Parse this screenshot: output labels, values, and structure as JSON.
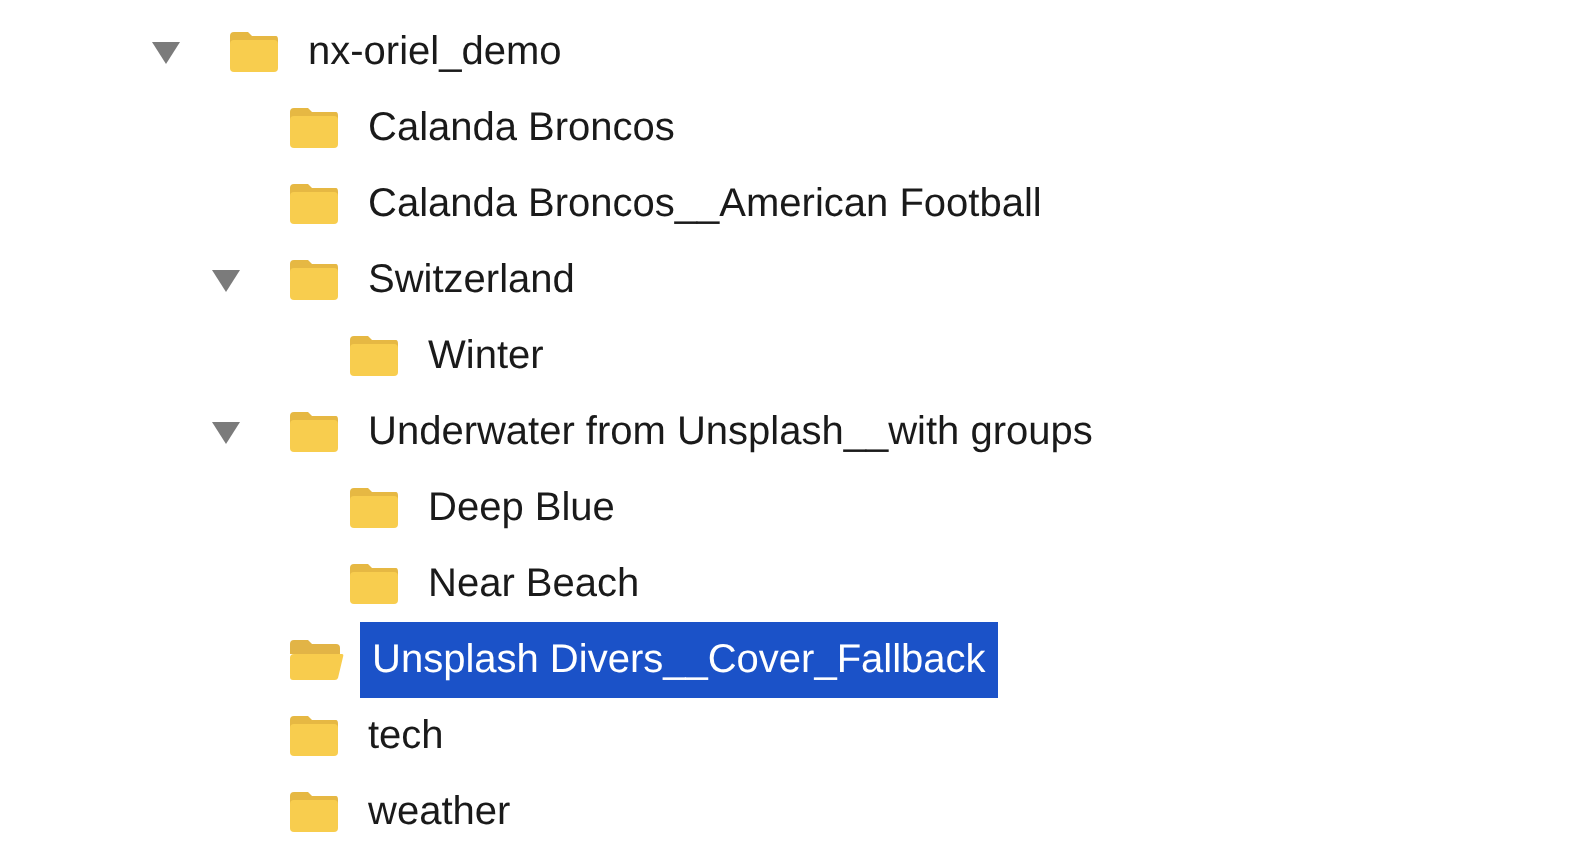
{
  "tree": [
    {
      "label": "nx-oriel_demo",
      "selected": false,
      "expanded": true,
      "children": [
        {
          "label": "Calanda Broncos",
          "selected": false
        },
        {
          "label": "Calanda Broncos__American Football",
          "selected": false
        },
        {
          "label": "Switzerland",
          "selected": false,
          "expanded": true,
          "children": [
            {
              "label": "Winter",
              "selected": false
            }
          ]
        },
        {
          "label": "Underwater from Unsplash__with groups",
          "selected": false,
          "expanded": true,
          "children": [
            {
              "label": "Deep Blue",
              "selected": false
            },
            {
              "label": "Near Beach",
              "selected": false
            }
          ]
        },
        {
          "label": "Unsplash Divers__Cover_Fallback",
          "selected": true
        },
        {
          "label": "tech",
          "selected": false
        },
        {
          "label": "weather",
          "selected": false
        }
      ]
    }
  ]
}
